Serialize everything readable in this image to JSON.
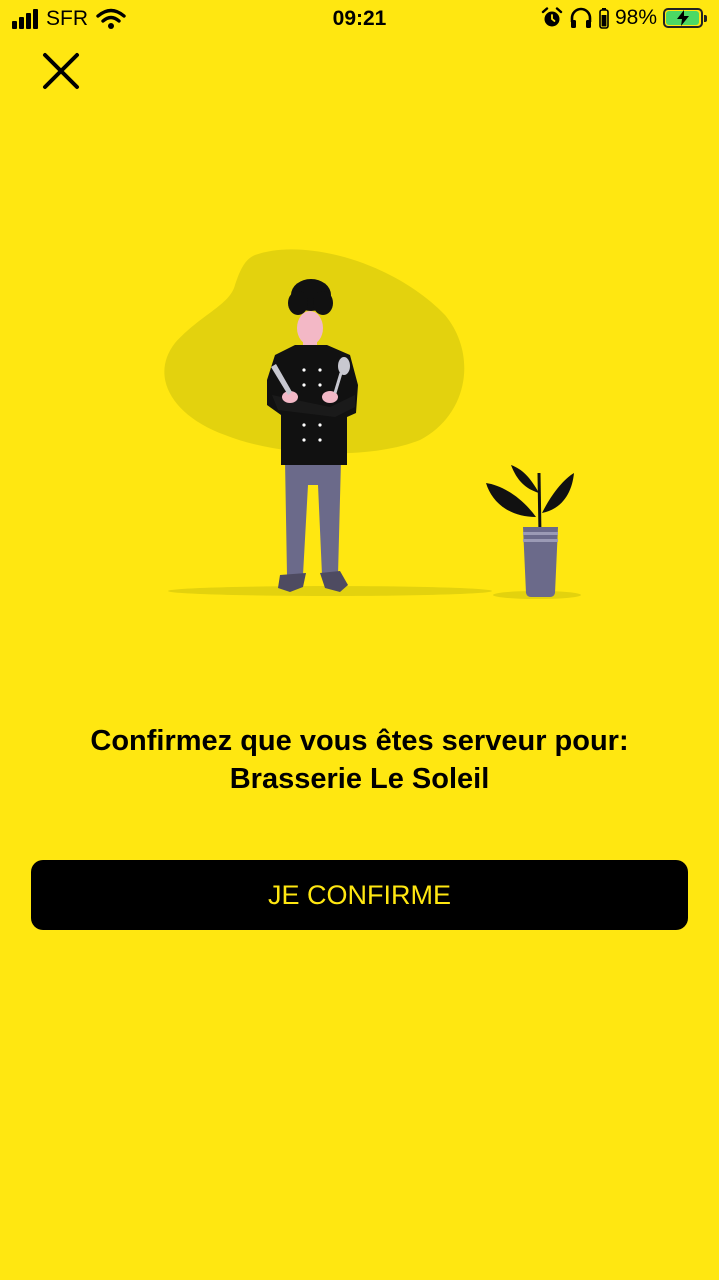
{
  "status_bar": {
    "carrier": "SFR",
    "time": "09:21",
    "battery_percent": "98%",
    "battery_level": 0.98,
    "battery_color": "#4CD964",
    "icons": [
      "signal-icon",
      "wifi-icon",
      "alarm-icon",
      "headphones-icon",
      "battery-icon"
    ]
  },
  "header": {
    "close_icon": "close-icon"
  },
  "illustration": {
    "subject": "chef-illustration",
    "plant": "plant-icon"
  },
  "message": {
    "line1": "Confirmez que vous êtes serveur pour:",
    "line2": "Brasserie Le Soleil"
  },
  "confirm_button": {
    "label": "JE CONFIRME",
    "text_color": "#FFE711",
    "background": "#000000"
  },
  "colors": {
    "background": "#FFE711",
    "blob": "#E3D20E",
    "text": "#000000"
  }
}
